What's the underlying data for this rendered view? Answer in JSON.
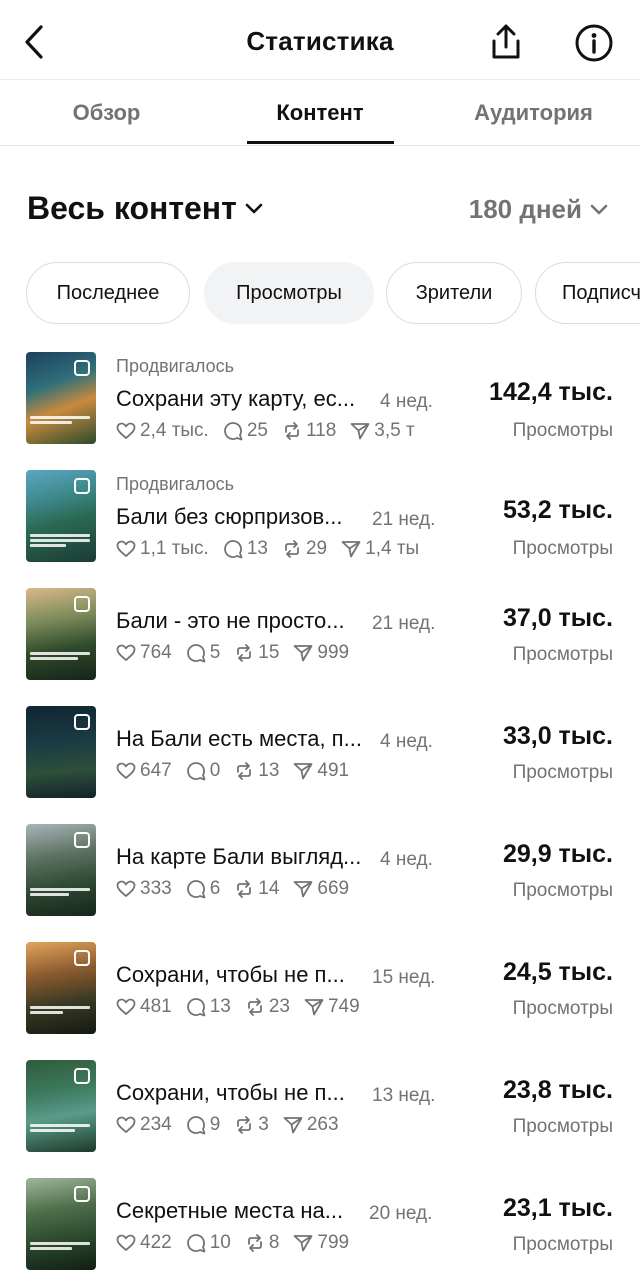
{
  "header": {
    "title": "Статистика"
  },
  "tabs": [
    {
      "label": "Обзор"
    },
    {
      "label": "Контент"
    },
    {
      "label": "Аудитория"
    }
  ],
  "filters": {
    "content": "Весь контент",
    "period": "180 дней"
  },
  "chips": [
    {
      "label": "Последнее"
    },
    {
      "label": "Просмотры"
    },
    {
      "label": "Зрители"
    },
    {
      "label": "Подписч"
    }
  ],
  "posts": [
    {
      "promo": "Продвигалось",
      "title": "Сохрани эту карту, ес...",
      "age": "4 нед.",
      "likes": "2,4 тыс.",
      "comments": "25",
      "reposts": "118",
      "shares": "3,5 т",
      "value": "142,4 тыс.",
      "label": "Просмотры"
    },
    {
      "promo": "Продвигалось",
      "title": "Бали без сюрпризов...",
      "age": "21 нед.",
      "likes": "1,1 тыс.",
      "comments": "13",
      "reposts": "29",
      "shares": "1,4 ты",
      "value": "53,2 тыс.",
      "label": "Просмотры"
    },
    {
      "title": "Бали - это не просто...",
      "age": "21 нед.",
      "likes": "764",
      "comments": "5",
      "reposts": "15",
      "shares": "999",
      "value": "37,0 тыс.",
      "label": "Просмотры"
    },
    {
      "title": "На Бали есть места, п...",
      "age": "4 нед.",
      "likes": "647",
      "comments": "0",
      "reposts": "13",
      "shares": "491",
      "value": "33,0 тыс.",
      "label": "Просмотры"
    },
    {
      "title": "На карте Бали выгляд...",
      "age": "4 нед.",
      "likes": "333",
      "comments": "6",
      "reposts": "14",
      "shares": "669",
      "value": "29,9 тыс.",
      "label": "Просмотры"
    },
    {
      "title": "Сохрани, чтобы не п...",
      "age": "15 нед.",
      "likes": "481",
      "comments": "13",
      "reposts": "23",
      "shares": "749",
      "value": "24,5 тыс.",
      "label": "Просмотры"
    },
    {
      "title": "Сохрани, чтобы не п...",
      "age": "13 нед.",
      "likes": "234",
      "comments": "9",
      "reposts": "3",
      "shares": "263",
      "value": "23,8 тыс.",
      "label": "Просмотры"
    },
    {
      "title": "Секретные места на...",
      "age": "20 нед.",
      "likes": "422",
      "comments": "10",
      "reposts": "8",
      "shares": "799",
      "value": "23,1 тыс.",
      "label": "Просмотры"
    }
  ]
}
